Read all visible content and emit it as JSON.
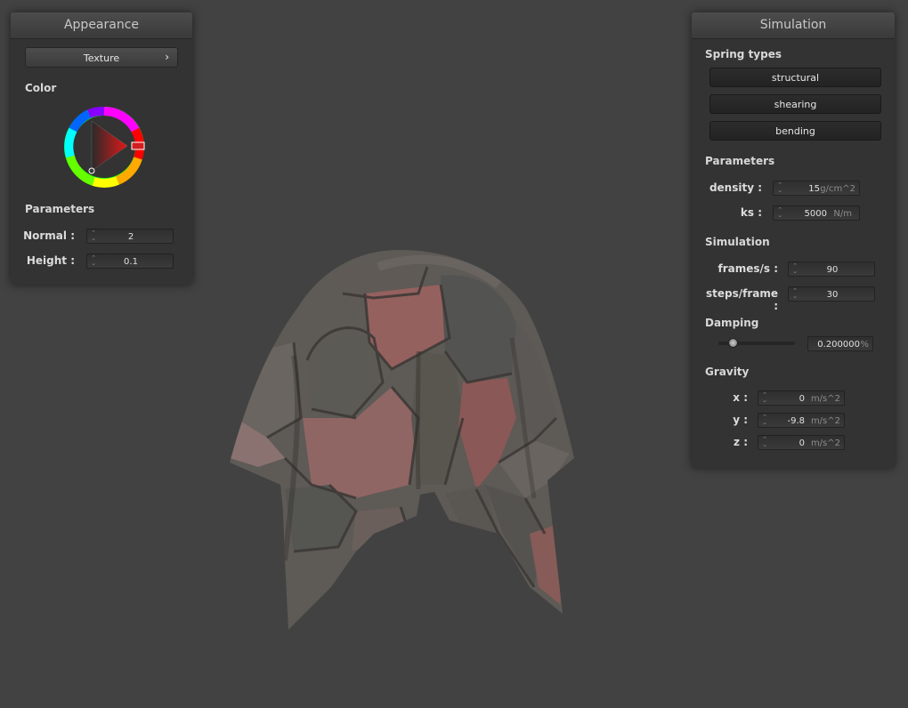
{
  "appearance": {
    "title": "Appearance",
    "texture_button": "Texture",
    "texture_chevron": "›",
    "color_label": "Color",
    "color_wheel_icon": "color-wheel-icon",
    "parameters_label": "Parameters",
    "normal_label": "Normal :",
    "normal_value": "2",
    "height_label": "Height :",
    "height_value": "0.1"
  },
  "simulation_panel": {
    "title": "Simulation",
    "spring_types_label": "Spring types",
    "spring_types": [
      "structural",
      "shearing",
      "bending"
    ],
    "parameters_label": "Parameters",
    "density_label": "density :",
    "density_value": "15",
    "density_unit": "g/cm^2",
    "ks_label": "ks :",
    "ks_value": "5000",
    "ks_unit": "N/m",
    "simulation_label": "Simulation",
    "fps_label": "frames/s :",
    "fps_value": "90",
    "steps_label": "steps/frame :",
    "steps_value": "30",
    "damping_label": "Damping",
    "damping_value": "0.200000",
    "damping_unit": "%",
    "damping_level": 0.2,
    "gravity_label": "Gravity",
    "gx_label": "x :",
    "gx_value": "0",
    "gy_label": "y :",
    "gy_value": "-9.8",
    "gz_label": "z :",
    "gz_value": "0",
    "gravity_unit": "m/s^2"
  },
  "colors": {
    "background": "#424242",
    "panel": "#333333",
    "selected_color": "#d21e1e"
  }
}
